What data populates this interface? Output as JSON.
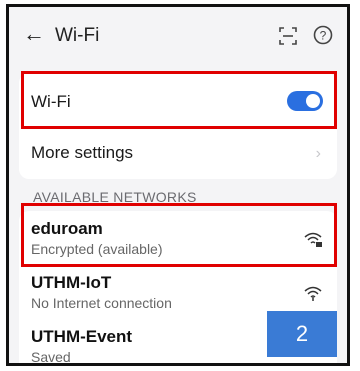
{
  "header": {
    "back_icon": "arrow-left-icon",
    "title": "Wi-Fi",
    "scan_icon": "scan-icon",
    "help_icon": "help-icon"
  },
  "wifi_toggle": {
    "label": "Wi-Fi",
    "state": "on",
    "color": "#2a6fe0"
  },
  "more_settings": {
    "label": "More settings"
  },
  "available_networks": {
    "label": "AVAILABLE NETWORKS",
    "items": [
      {
        "name": "eduroam",
        "status": "Encrypted (available)",
        "icon": "wifi-lock-icon"
      },
      {
        "name": "UTHM-IoT",
        "status": "No Internet connection",
        "icon": "wifi-icon"
      },
      {
        "name": "UTHM-Event",
        "status": "Saved",
        "icon": "wifi-icon"
      }
    ]
  },
  "annotation": {
    "number": "2",
    "color": "#3a7bd5"
  },
  "highlight_color": "#e00000"
}
